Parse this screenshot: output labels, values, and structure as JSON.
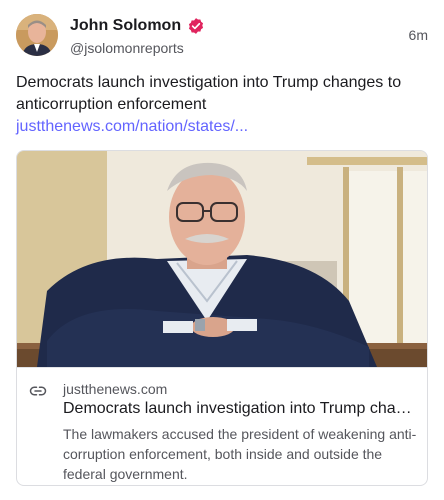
{
  "author": {
    "name": "John Solomon",
    "handle": "@jsolomonreports",
    "time": "6m",
    "verified_color": "#e0245e"
  },
  "post": {
    "text": "Democrats launch investigation into Trump changes to anticorruption enforcement ",
    "link_text": "justthenews.com/nation/states/..."
  },
  "card": {
    "domain": "justthenews.com",
    "title": "Democrats launch investigation into Trump changes to anticorruption enforcement",
    "description": "The lawmakers accused the president of weakening anti-corruption enforcement, both inside and outside the federal government."
  },
  "colors": {
    "link": "#6364ff",
    "muted": "#55565c"
  }
}
